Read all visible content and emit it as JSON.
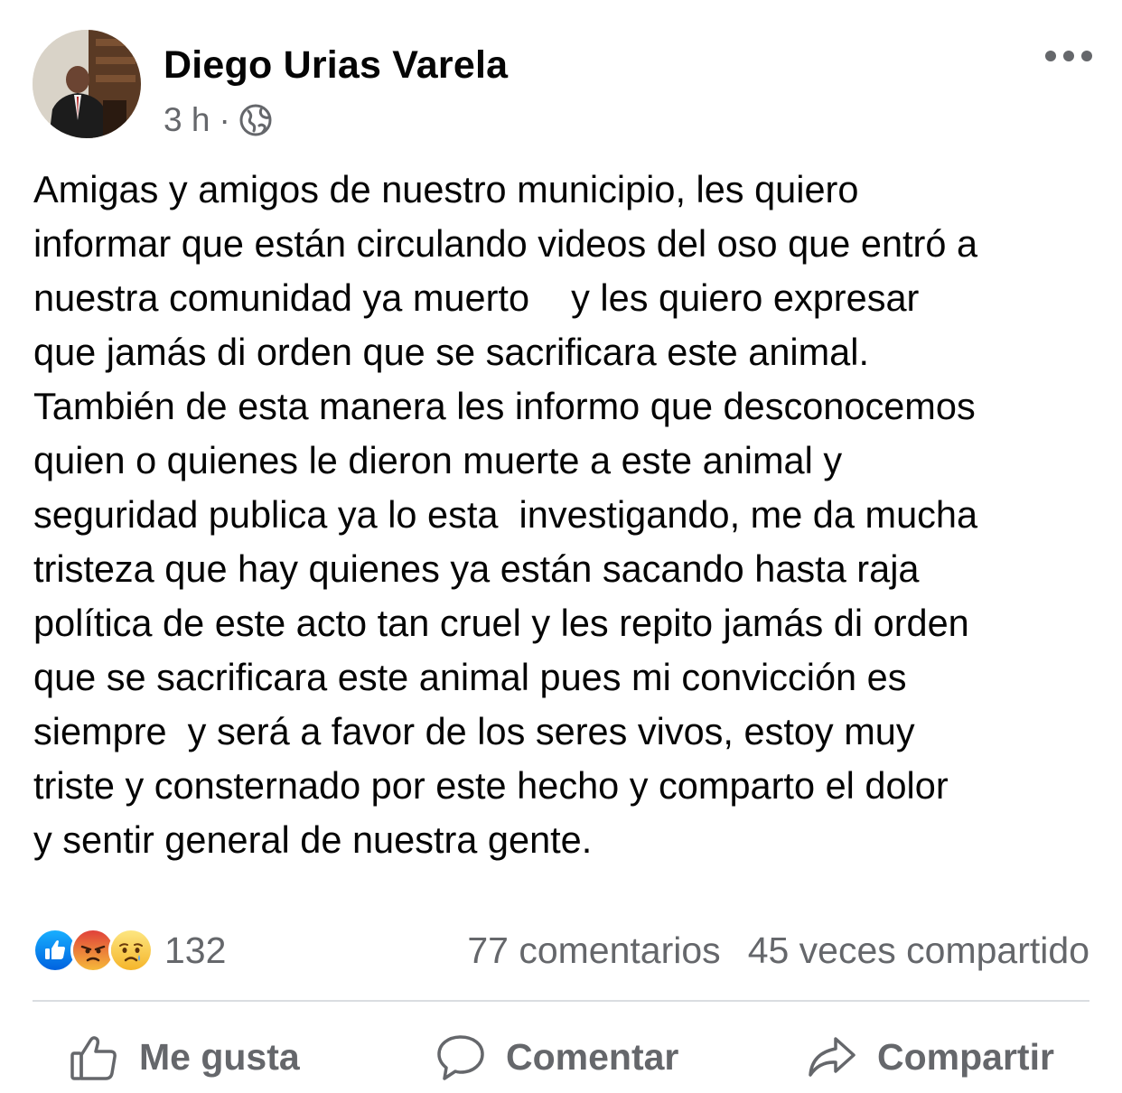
{
  "post": {
    "author": "Diego Urias Varela",
    "time": "3 h",
    "separator": "·",
    "audience_icon": "globe-icon",
    "more_icon": "more-options-icon",
    "text_lines": [
      "Amigas y amigos de nuestro municipio, les quiero",
      "informar que están circulando videos del oso que entró a",
      "nuestra comunidad ya muerto    y les quiero expresar",
      "que jamás di orden que se sacrificara este animal.",
      "También de esta manera les informo que desconocemos",
      "quien o quienes le dieron muerte a este animal y",
      "seguridad publica ya lo esta  investigando, me da mucha",
      "tristeza que hay quienes ya están sacando hasta raja",
      "política de este acto tan cruel y les repito jamás di orden",
      "que se sacrificara este animal pues mi convicción es",
      "siempre  y será a favor de los seres vivos, estoy muy",
      "triste y consternado por este hecho y comparto el dolor",
      "y sentir general de nuestra gente."
    ]
  },
  "stats": {
    "reaction_icons": [
      "like-reaction-icon",
      "angry-reaction-icon",
      "sad-reaction-icon"
    ],
    "reaction_count": "132",
    "comments": "77 comentarios",
    "shares": "45 veces compartido"
  },
  "actions": {
    "like": "Me gusta",
    "comment": "Comentar",
    "share": "Compartir"
  },
  "colors": {
    "like_blue": "#1877f2",
    "angry_orange": "#f0612f",
    "sad_yellow": "#f7c537",
    "secondary_text": "#65676b",
    "divider": "#dadde1"
  }
}
